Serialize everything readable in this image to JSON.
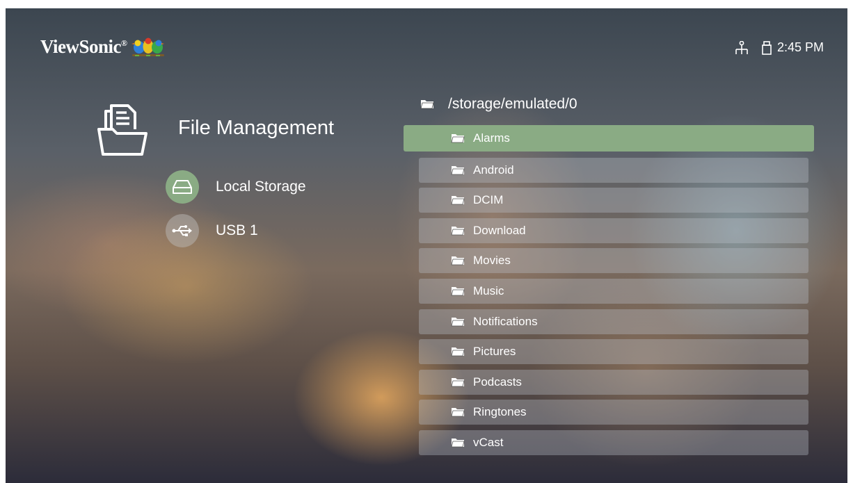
{
  "brand": {
    "name": "ViewSonic",
    "reg_mark": "®"
  },
  "status": {
    "time": "2:45 PM",
    "icons": [
      "network-icon",
      "usb-drive-icon"
    ]
  },
  "sidebar": {
    "title": "File Management",
    "storages": [
      {
        "label": "Local Storage",
        "icon": "hard-drive-icon",
        "selected": true
      },
      {
        "label": "USB 1",
        "icon": "usb-icon",
        "selected": false
      }
    ]
  },
  "browser": {
    "path": "/storage/emulated/0",
    "folders": [
      {
        "label": "Alarms"
      },
      {
        "label": "Android"
      },
      {
        "label": "DCIM"
      },
      {
        "label": "Download"
      },
      {
        "label": "Movies"
      },
      {
        "label": "Music"
      },
      {
        "label": "Notifications"
      },
      {
        "label": "Pictures"
      },
      {
        "label": "Podcasts"
      },
      {
        "label": "Ringtones"
      },
      {
        "label": "vCast"
      }
    ],
    "selected_index": 0
  },
  "colors": {
    "accent": "#8aab84",
    "row": "#b9bec8",
    "text": "#ffffff"
  }
}
